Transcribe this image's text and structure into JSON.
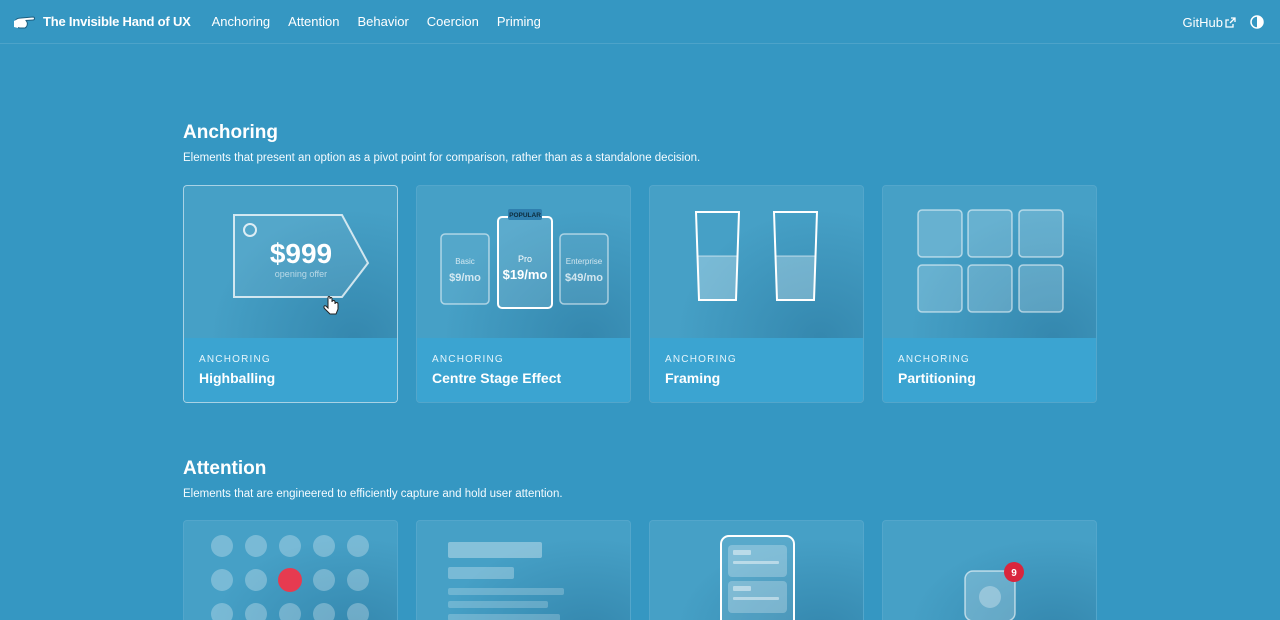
{
  "header": {
    "brand": "The Invisible Hand of UX",
    "nav": [
      "Anchoring",
      "Attention",
      "Behavior",
      "Coercion",
      "Priming"
    ],
    "github": "GitHub"
  },
  "sections": [
    {
      "title": "Anchoring",
      "description": "Elements that present an option as a pivot point for comparison, rather than as a standalone decision.",
      "cards": [
        {
          "category": "ANCHORING",
          "name": "Highballing",
          "price": "$999",
          "caption": "opening offer"
        },
        {
          "category": "ANCHORING",
          "name": "Centre Stage Effect",
          "badge": "POPULAR",
          "plans": [
            {
              "label": "Basic",
              "price": "$9/mo"
            },
            {
              "label": "Pro",
              "price": "$19/mo"
            },
            {
              "label": "Enterprise",
              "price": "$49/mo"
            }
          ]
        },
        {
          "category": "ANCHORING",
          "name": "Framing"
        },
        {
          "category": "ANCHORING",
          "name": "Partitioning"
        }
      ]
    },
    {
      "title": "Attention",
      "description": "Elements that are engineered to efficiently capture and hold user attention.",
      "notification_count": "9"
    }
  ],
  "colors": {
    "background": "#3597c2",
    "card_footer": "#3ba4d1",
    "highlight_dot": "#e63b50",
    "badge": "#d9263d"
  }
}
